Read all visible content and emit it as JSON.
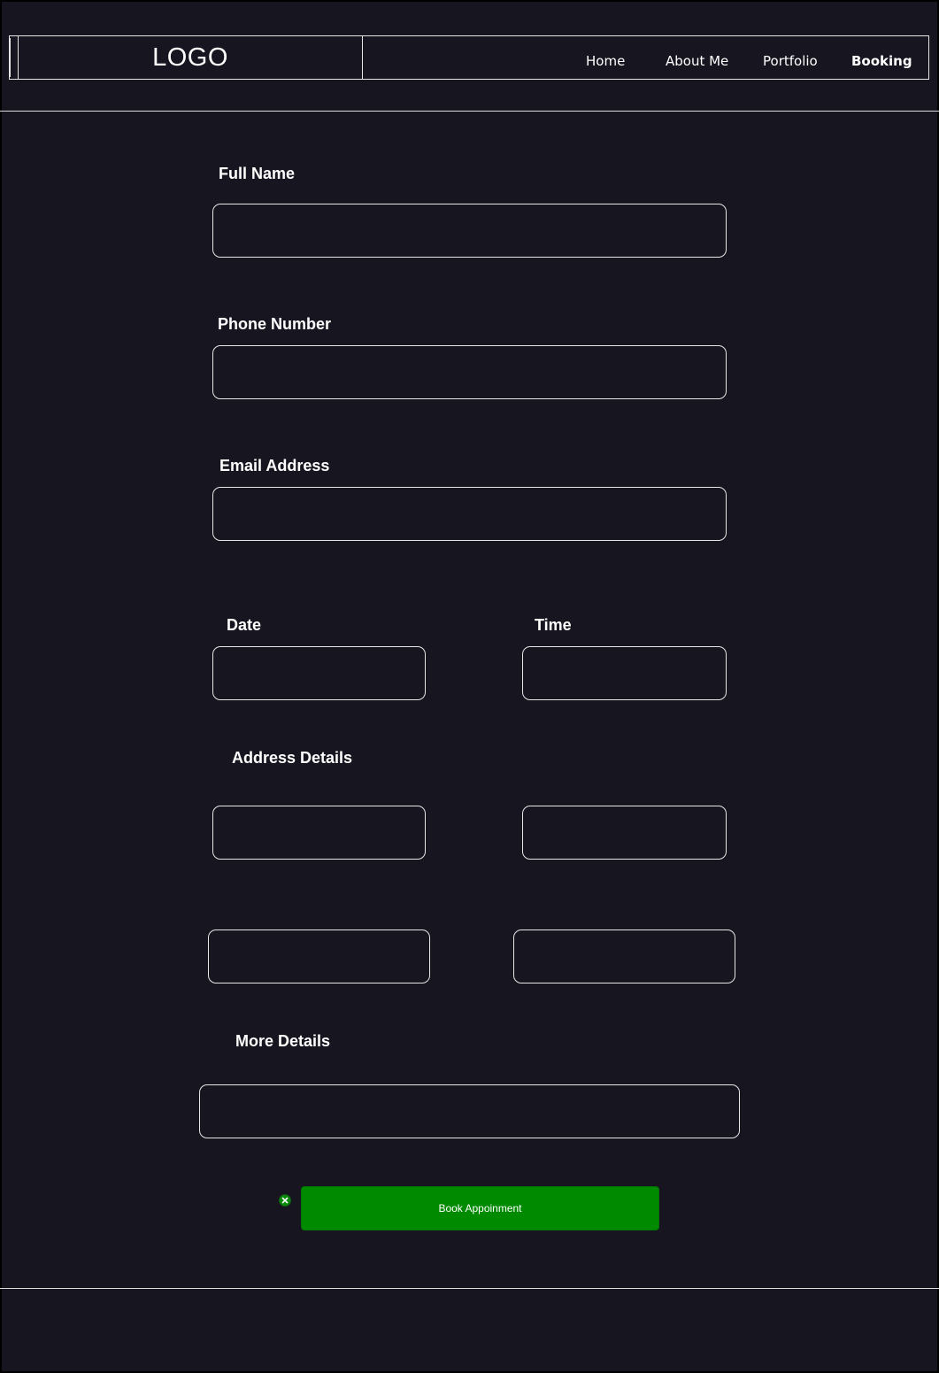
{
  "header": {
    "logo": "LOGO",
    "nav": [
      {
        "label": "Home",
        "active": false
      },
      {
        "label": "About Me",
        "active": false
      },
      {
        "label": "Portfolio",
        "active": false
      },
      {
        "label": "Booking",
        "active": true
      }
    ]
  },
  "form": {
    "full_name": {
      "label": "Full Name",
      "value": ""
    },
    "phone": {
      "label": "Phone Number",
      "value": ""
    },
    "email": {
      "label": "Email Address",
      "value": ""
    },
    "date": {
      "label": "Date",
      "value": ""
    },
    "time": {
      "label": "Time",
      "value": ""
    },
    "address": {
      "label": "Address Details",
      "fields": [
        "",
        "",
        "",
        ""
      ]
    },
    "more_details": {
      "label": "More Details",
      "value": ""
    },
    "submit_label": "Book Appoinment"
  },
  "colors": {
    "background": "#17151f",
    "line": "#e6e6e6",
    "button": "#008a00",
    "text": "#ffffff"
  },
  "icons": {
    "close_badge": "close-icon"
  }
}
